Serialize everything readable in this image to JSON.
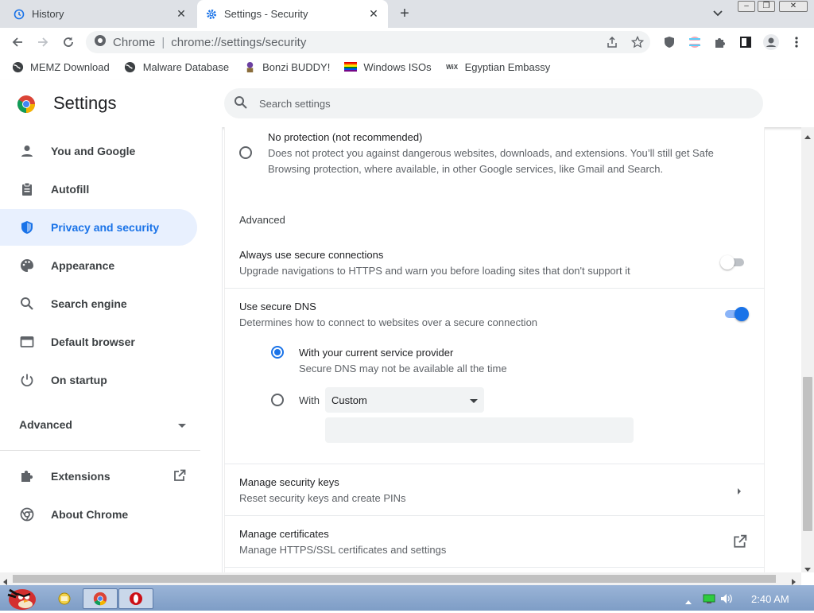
{
  "tabs": [
    {
      "title": "History",
      "icon": "history-icon"
    },
    {
      "title": "Settings - Security",
      "icon": "gear-icon"
    }
  ],
  "omnibox": {
    "label": "Chrome",
    "url": "chrome://settings/security"
  },
  "bookmarks": [
    {
      "label": "MEMZ Download",
      "icon": "globe-icon"
    },
    {
      "label": "Malware Database",
      "icon": "globe-icon"
    },
    {
      "label": "Bonzi BUDDY!",
      "icon": "bonzi-icon"
    },
    {
      "label": "Windows ISOs",
      "icon": "rainbow-flag-icon"
    },
    {
      "label": "Egyptian Embassy",
      "icon": "wix-icon"
    }
  ],
  "header": {
    "title": "Settings",
    "search_placeholder": "Search settings"
  },
  "sidebar": {
    "items": [
      {
        "label": "You and Google",
        "icon": "person-icon"
      },
      {
        "label": "Autofill",
        "icon": "clipboard-icon"
      },
      {
        "label": "Privacy and security",
        "icon": "shield-icon",
        "active": true
      },
      {
        "label": "Appearance",
        "icon": "palette-icon"
      },
      {
        "label": "Search engine",
        "icon": "search-icon"
      },
      {
        "label": "Default browser",
        "icon": "browser-icon"
      },
      {
        "label": "On startup",
        "icon": "power-icon"
      }
    ],
    "advanced_label": "Advanced",
    "extensions_label": "Extensions",
    "about_label": "About Chrome"
  },
  "main": {
    "no_protection": {
      "title": "No protection (not recommended)",
      "desc_line1": "Does not protect you against dangerous websites, downloads, and extensions. You’ll still get Safe",
      "desc_line2": "Browsing protection, where available, in other Google services, like Gmail and Search.",
      "selected": false
    },
    "advanced_heading": "Advanced",
    "secure_connections": {
      "title": "Always use secure connections",
      "desc": "Upgrade navigations to HTTPS and warn you before loading sites that don't support it",
      "enabled": false
    },
    "secure_dns": {
      "title": "Use secure DNS",
      "desc": "Determines how to connect to websites over a secure connection",
      "enabled": true,
      "option_current": {
        "title": "With your current service provider",
        "desc": "Secure DNS may not be available all the time",
        "selected": true
      },
      "option_custom": {
        "label": "With",
        "select_value": "Custom",
        "selected": false
      }
    },
    "security_keys": {
      "title": "Manage security keys",
      "desc": "Reset security keys and create PINs"
    },
    "certificates": {
      "title": "Manage certificates",
      "desc": "Manage HTTPS/SSL certificates and settings"
    }
  },
  "taskbar": {
    "clock": "2:40 AM"
  },
  "colors": {
    "accent": "#1a73e8",
    "active_bg": "#e8f0fe"
  }
}
